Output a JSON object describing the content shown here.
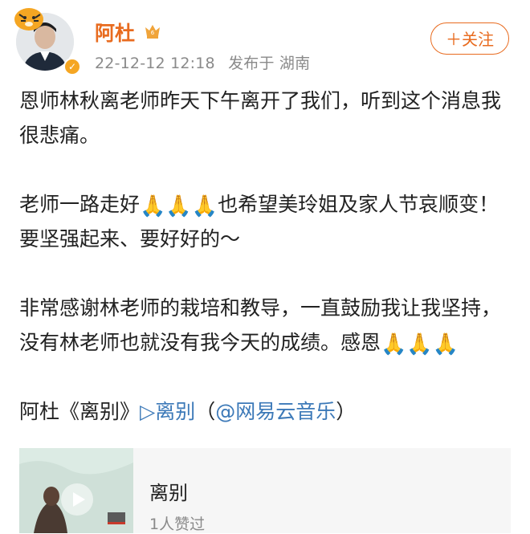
{
  "post": {
    "author": "阿杜",
    "timestamp": "22-12-12 12:18",
    "source": "发布于 湖南",
    "follow_label": "＋关注",
    "paragraph1": "恩师林秋离老师昨天下午离开了我们，听到这个消息我很悲痛。",
    "paragraph2_a": "老师一路走好",
    "paragraph2_b": "也希望美玲姐及家人节哀顺变！要坚强起来、要好好的～",
    "paragraph3": "非常感谢林老师的栽培和教导，一直鼓励我让我坚持，没有林老师也就没有我今天的成绩。感恩",
    "pray_emoji": "🙏",
    "song_line_prefix": "阿杜《离别》",
    "song_link": "▷离别",
    "song_source_open": "（",
    "song_source_link": "@网易云音乐",
    "song_source_close": "）"
  },
  "music_card": {
    "title": "离别",
    "likes": "1人赞过"
  },
  "colors": {
    "accent": "#e86b1f",
    "link": "#3c79b8",
    "meta": "#8a8a8a"
  },
  "icons": {
    "avatar": "avatar-icon",
    "verified": "verified-badge-icon",
    "vip": "vip-crown-icon",
    "pray": "pray-emoji-icon",
    "play": "play-icon"
  }
}
